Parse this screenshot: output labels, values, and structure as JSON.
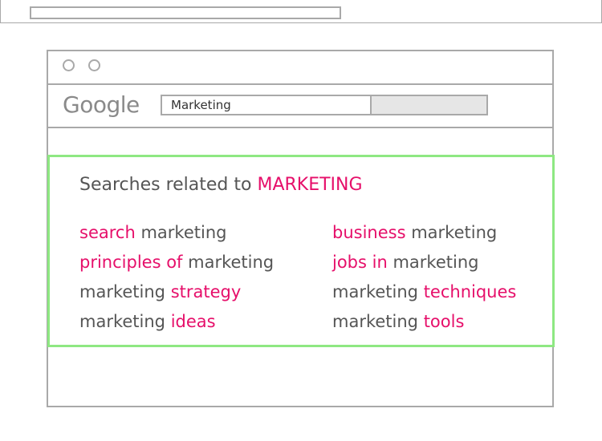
{
  "search": {
    "logo_text": "Google",
    "query": "Marketing"
  },
  "related": {
    "heading_prefix": "Searches related to",
    "heading_term": "MARKETING",
    "left": [
      {
        "highlight_before": "search",
        "base": "marketing",
        "highlight_after": ""
      },
      {
        "highlight_before": "principles of",
        "base": "marketing",
        "highlight_after": ""
      },
      {
        "highlight_before": "",
        "base": "marketing",
        "highlight_after": "strategy"
      },
      {
        "highlight_before": "",
        "base": "marketing",
        "highlight_after": "ideas"
      }
    ],
    "right": [
      {
        "highlight_before": "business",
        "base": "marketing",
        "highlight_after": ""
      },
      {
        "highlight_before": "jobs in",
        "base": "marketing",
        "highlight_after": ""
      },
      {
        "highlight_before": "",
        "base": "marketing",
        "highlight_after": "techniques"
      },
      {
        "highlight_before": "",
        "base": "marketing",
        "highlight_after": "tools"
      }
    ]
  },
  "colors": {
    "accent": "#e60f6a",
    "panel_border": "#8ee882",
    "wireframe": "#a9a9a9",
    "text": "#555555"
  }
}
